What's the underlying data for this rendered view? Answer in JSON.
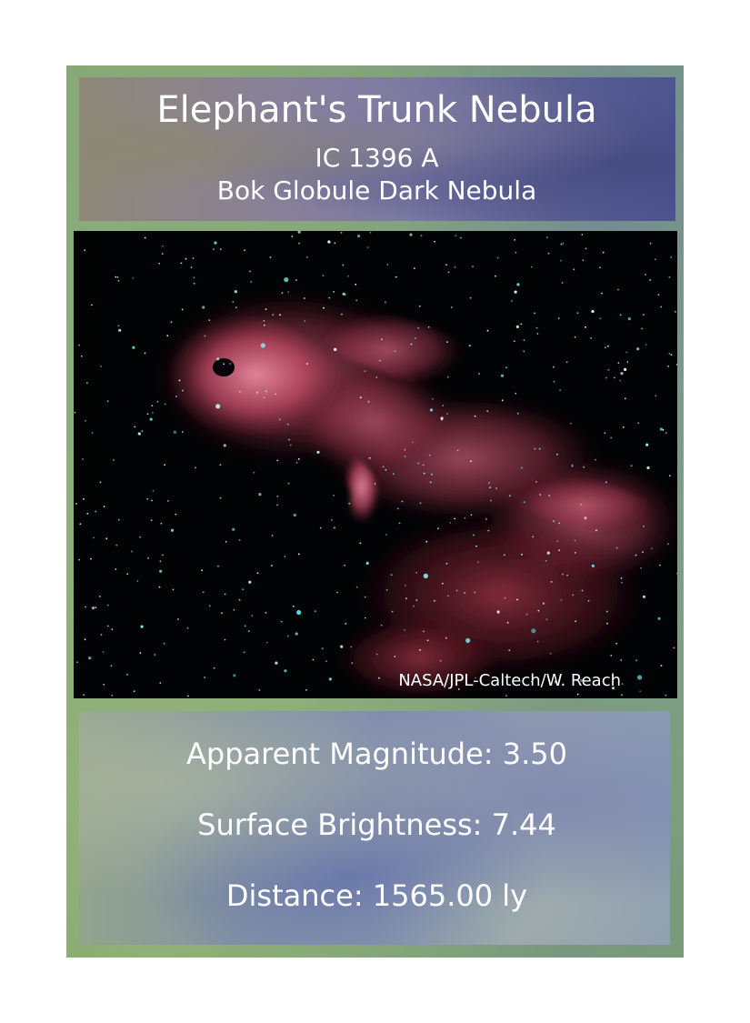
{
  "card": {
    "title": "Elephant's Trunk Nebula",
    "designation": "IC 1396 A",
    "object_type": "Bok Globule Dark Nebula",
    "image": {
      "credit": "NASA/JPL-Caltech/W. Reach",
      "subject": "nebula-starfield-photo"
    },
    "stats": {
      "apparent_magnitude": "Apparent Magnitude: 3.50",
      "surface_brightness": "Surface Brightness: 7.44",
      "distance": "Distance: 1565.00 ly"
    }
  },
  "colors": {
    "frame_green": "#88ad7f",
    "header_left": "#8f8877",
    "header_right": "#4d5590",
    "nebula_red": "#b84a5f",
    "star_cyan": "#7ff5f0",
    "text": "#ffffff"
  }
}
